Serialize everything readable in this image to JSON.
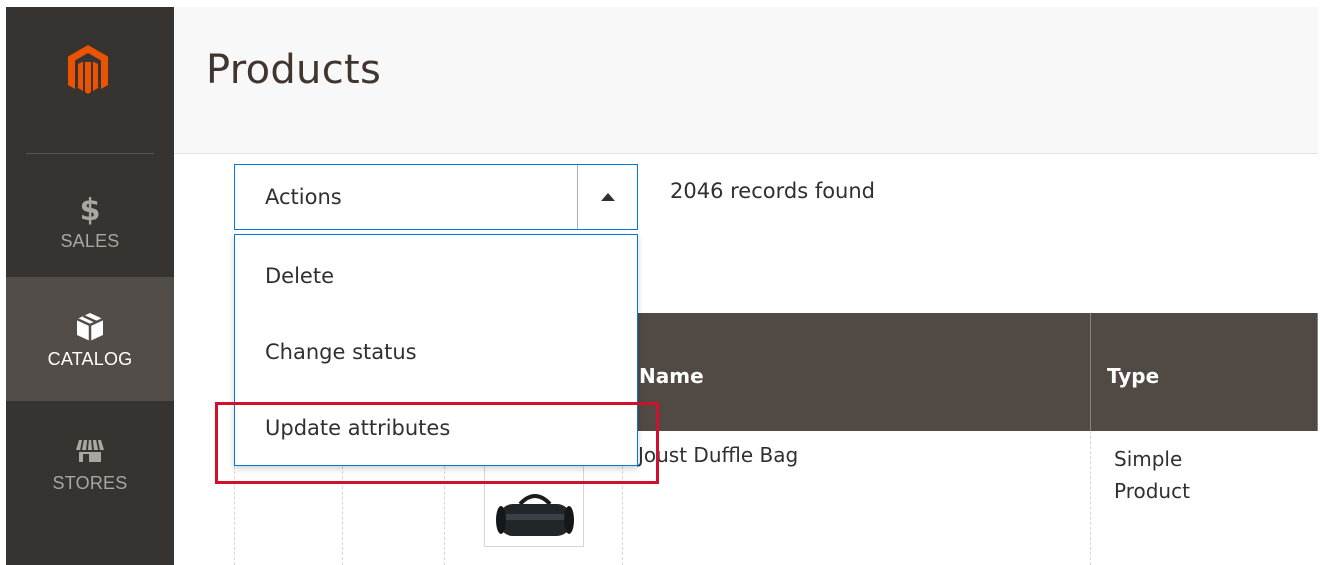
{
  "app": {
    "page_title": "Products"
  },
  "sidebar": {
    "logo_icon": "magento-logo-icon",
    "items": [
      {
        "label": "SALES",
        "icon": "dollar-icon",
        "active": false
      },
      {
        "label": "CATALOG",
        "icon": "box-icon",
        "active": true
      },
      {
        "label": "STORES",
        "icon": "storefront-icon",
        "active": false
      }
    ]
  },
  "toolbar": {
    "actions_label": "Actions",
    "records_found": "2046 records found"
  },
  "actions_menu": {
    "items": [
      {
        "label": "Delete"
      },
      {
        "label": "Change status"
      },
      {
        "label": "Update attributes",
        "highlighted": true
      }
    ]
  },
  "grid": {
    "columns": [
      {
        "label": "Name"
      },
      {
        "label": "Type"
      }
    ],
    "rows": [
      {
        "name": "Joust Duffle Bag",
        "type": "Simple Product",
        "thumbnail_icon": "duffle-bag-image"
      }
    ]
  },
  "colors": {
    "sidebar_bg": "#373330",
    "sidebar_active_bg": "#524d49",
    "logo_orange": "#eb5202",
    "grid_header_bg": "#514943",
    "focus_blue": "#007bdb",
    "highlight_red": "#d0112b"
  }
}
